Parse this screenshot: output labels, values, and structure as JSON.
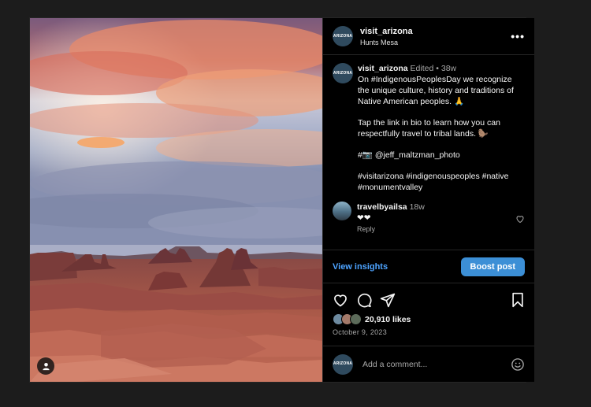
{
  "post": {
    "username": "visit_arizona",
    "location": "Hunts Mesa",
    "avatar_text": "ARIZONA",
    "more_label": "•••"
  },
  "caption": {
    "username": "visit_arizona",
    "edited": "Edited",
    "sep": "•",
    "age": "38w",
    "line1": "On #IndigenousPeoplesDay we recognize the unique culture, history and traditions of Native American peoples. 🙏",
    "line2": "Tap the link in bio to learn how you can respectfully travel to tribal lands. 🦫",
    "line3": "#📷 @jeff_maltzman_photo",
    "line4": "#visitarizona #indigenouspeoples #native #monumentvalley"
  },
  "reply": {
    "username": "travelbyailsa",
    "age": "18w",
    "text": "❤❤",
    "reply_label": "Reply"
  },
  "actions": {
    "insights": "View insights",
    "boost": "Boost post"
  },
  "stats": {
    "likes": "20,910 likes",
    "date": "October 9, 2023"
  },
  "comment_box": {
    "placeholder": "Add a comment..."
  },
  "icons": {
    "like": "heart-icon",
    "comment": "comment-icon",
    "share": "share-icon",
    "save": "bookmark-icon",
    "emoji": "emoji-icon",
    "tag": "user-tag-icon",
    "more": "more-icon"
  }
}
